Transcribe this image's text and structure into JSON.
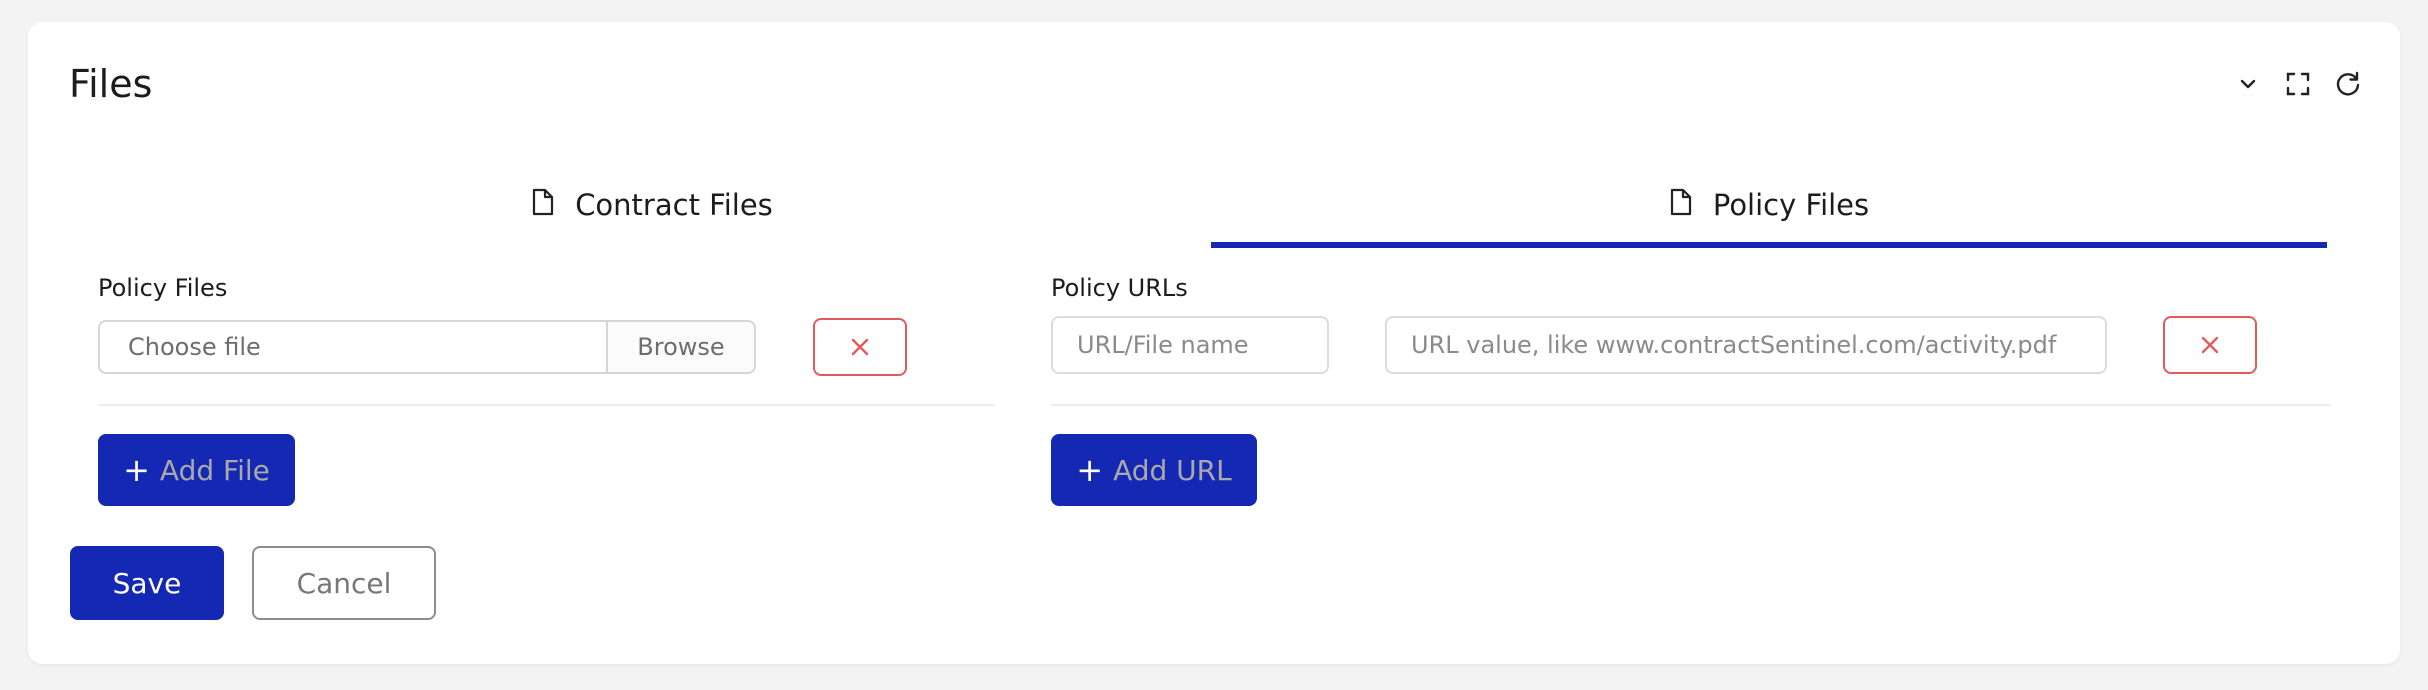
{
  "panel": {
    "title": "Files"
  },
  "toolbar": {
    "icons": [
      "chevron-down-icon",
      "fullscreen-icon",
      "refresh-icon"
    ]
  },
  "tabs": [
    {
      "label": "Contract Files",
      "icon": "file-icon",
      "active": false
    },
    {
      "label": "Policy Files",
      "icon": "file-icon",
      "active": true
    }
  ],
  "policy_files": {
    "label": "Policy Files",
    "file_input": {
      "placeholder": "Choose file",
      "browse_label": "Browse"
    },
    "add_button": "Add File"
  },
  "policy_urls": {
    "label": "Policy URLs",
    "name_input": {
      "placeholder": "URL/File name"
    },
    "value_input": {
      "placeholder": "URL value, like www.contractSentinel.com/activity.pdf"
    },
    "add_button": "Add URL"
  },
  "actions": {
    "save": "Save",
    "cancel": "Cancel"
  },
  "colors": {
    "accent": "#1428b4",
    "danger": "#e05c5c",
    "background": "#f3f3f3"
  }
}
